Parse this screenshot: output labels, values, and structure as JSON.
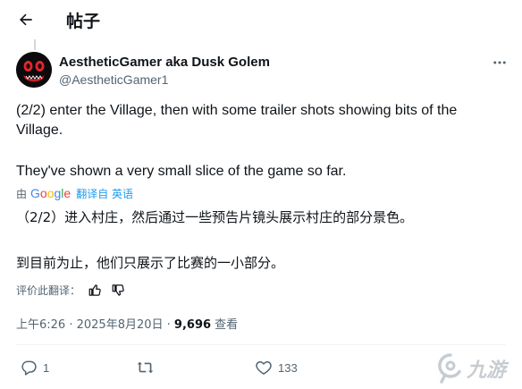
{
  "header": {
    "title": "帖子",
    "back_icon": "arrow-left-icon"
  },
  "author": {
    "name": "AestheticGamer aka Dusk Golem",
    "handle": "@AestheticGamer1",
    "avatar_icon": "avatar-creature"
  },
  "tweet": {
    "line1": "(2/2) enter the Village, then with some trailer shots showing bits of the",
    "line2": "Village.",
    "line3": "They've shown a very small slice of the game so far."
  },
  "translation": {
    "by_label": "由",
    "provider": "Google",
    "translate_link": "翻译自 英语",
    "zh_line1": "（2/2）进入村庄，然后通过一些预告片镜头展示村庄的部分景色。",
    "zh_line2": "到目前为止，他们只展示了比赛的一小部分。",
    "rate_label": "评价此翻译："
  },
  "meta": {
    "time": "上午6:26",
    "sep1": " · ",
    "date": "2025年8月20日",
    "sep2": " · ",
    "views": "9,696",
    "views_label": " 查看"
  },
  "actions": {
    "reply_count": "1",
    "retweet_count": "",
    "like_count": "133"
  },
  "watermark": {
    "text": "九游"
  },
  "colors": {
    "text": "#0f1419",
    "muted": "#536471",
    "link": "#1d9bf0",
    "divider": "#eff3f4"
  }
}
